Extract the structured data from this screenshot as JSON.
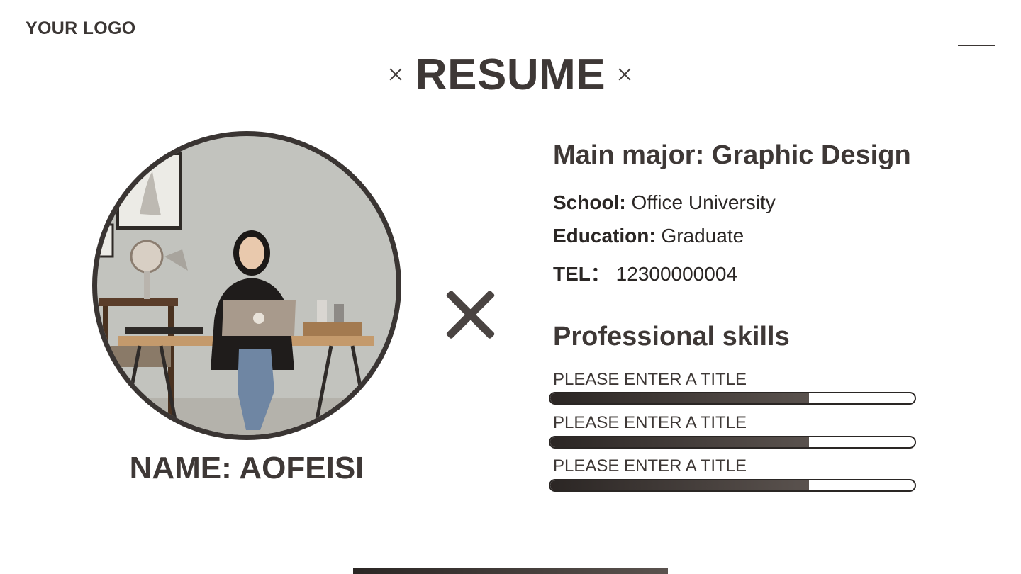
{
  "header": {
    "logo": "YOUR LOGO",
    "title": "RESUME"
  },
  "profile": {
    "name": "NAME: AOFEISI"
  },
  "info": {
    "major": "Main major: Graphic Design",
    "school_label": "School:",
    "school_value": "Office University",
    "education_label": "Education:",
    "education_value": "Graduate",
    "tel_label": "TEL：",
    "tel_value": "12300000004"
  },
  "skills": {
    "heading": "Professional skills",
    "items": [
      {
        "title": "PLEASE ENTER A TITLE",
        "level": 0.71
      },
      {
        "title": "PLEASE ENTER A TITLE",
        "level": 0.71
      },
      {
        "title": "PLEASE ENTER A TITLE",
        "level": 0.71
      }
    ]
  },
  "colors": {
    "accent_dark": "#2b2624",
    "accent_mid": "#5a524e",
    "text": "#3e3836"
  },
  "icons": [
    "close-icon",
    "close-icon",
    "cross-icon"
  ]
}
